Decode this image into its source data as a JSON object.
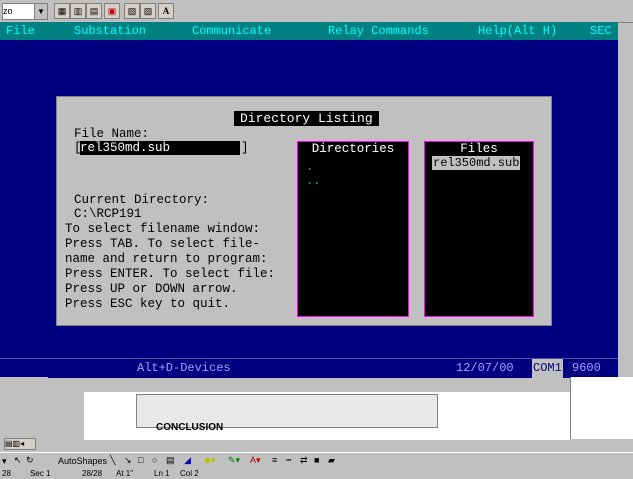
{
  "toolbar": {
    "combo_value": "zo",
    "font_button": "A"
  },
  "menu": [
    "File",
    "Substation",
    "Communicate",
    "Relay Commands",
    "Help(Alt H)",
    "SEC"
  ],
  "dialog": {
    "title": "Directory Listing",
    "file_name_label": "File Name:",
    "file_name_value": "rel350md.sub",
    "current_dir_label": "Current Directory:",
    "current_dir_value": "C:\\RCP191",
    "instructions": [
      "To select filename window:",
      "Press TAB. To select file-",
      "name and return to program:",
      "Press ENTER. To select file:",
      "Press UP or DOWN arrow.",
      "Press ESC key to quit."
    ],
    "directories_title": "Directories",
    "directories": [
      ".",
      ".."
    ],
    "files_title": "Files",
    "files": [
      "rel350md.sub"
    ]
  },
  "statusbar": {
    "hint": "Alt+D-Devices",
    "date": "12/07/00",
    "port": "COM1",
    "baud": "9600"
  },
  "word": {
    "conclusion": "CONCLUSION",
    "autoshapes": "AutoShapes",
    "status": {
      "sec": "Sec 1",
      "pages": "28/28",
      "at": "At 1\"",
      "ln": "Ln 1",
      "col": "Col 2",
      "page": "28"
    }
  }
}
